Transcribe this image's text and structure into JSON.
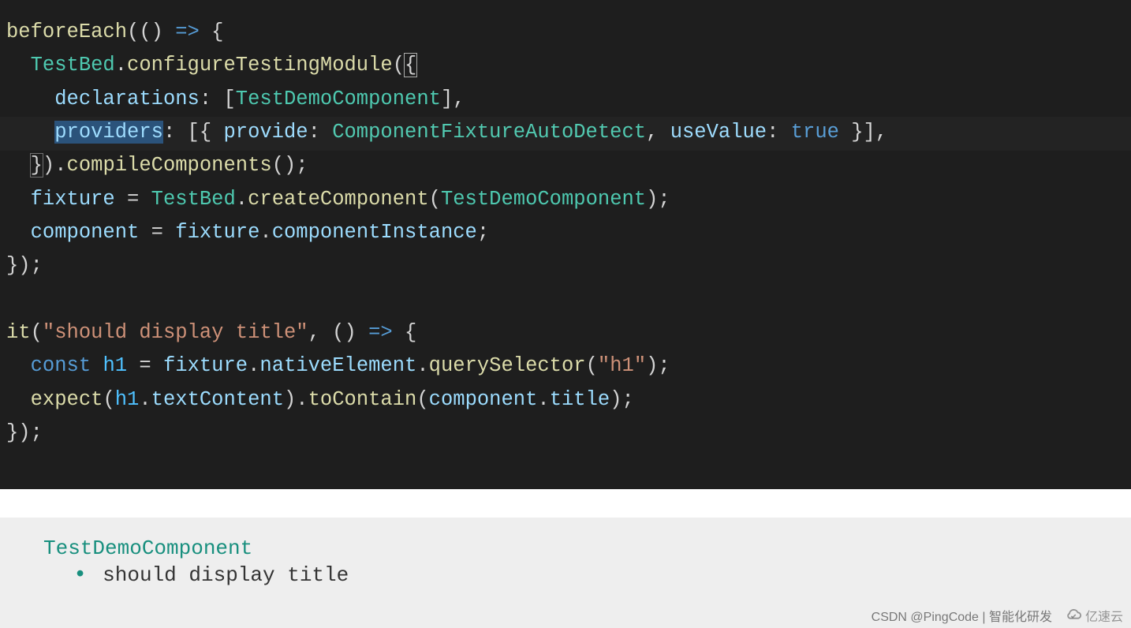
{
  "code": {
    "tokens": [
      [
        {
          "t": "beforeEach",
          "c": "t-fn"
        },
        {
          "t": "(() ",
          "c": "t-pn"
        },
        {
          "t": "=>",
          "c": "t-key"
        },
        {
          "t": " {",
          "c": "t-pn"
        }
      ],
      [
        {
          "t": "  ",
          "c": ""
        },
        {
          "t": "TestBed",
          "c": "t-cls"
        },
        {
          "t": ".",
          "c": "t-pn"
        },
        {
          "t": "configureTestingModule",
          "c": "t-fn"
        },
        {
          "t": "(",
          "c": "t-pn"
        },
        {
          "t": "{",
          "c": "t-pn cursor-box"
        }
      ],
      [
        {
          "t": "    ",
          "c": ""
        },
        {
          "t": "declarations",
          "c": "t-prop"
        },
        {
          "t": ": [",
          "c": "t-pn"
        },
        {
          "t": "TestDemoComponent",
          "c": "t-cls"
        },
        {
          "t": "],",
          "c": "t-pn"
        }
      ],
      [
        {
          "t": "    ",
          "c": ""
        },
        {
          "t": "providers",
          "c": "t-prop hl"
        },
        {
          "t": ": [{ ",
          "c": "t-pn"
        },
        {
          "t": "provide",
          "c": "t-prop"
        },
        {
          "t": ": ",
          "c": "t-pn"
        },
        {
          "t": "ComponentFixtureAutoDetect",
          "c": "t-cls"
        },
        {
          "t": ", ",
          "c": "t-pn"
        },
        {
          "t": "useValue",
          "c": "t-prop"
        },
        {
          "t": ": ",
          "c": "t-pn"
        },
        {
          "t": "true",
          "c": "t-key"
        },
        {
          "t": " }],",
          "c": "t-pn"
        }
      ],
      [
        {
          "t": "  ",
          "c": ""
        },
        {
          "t": "}",
          "c": "t-pn bracket-box"
        },
        {
          "t": ").",
          "c": "t-pn"
        },
        {
          "t": "compileComponents",
          "c": "t-fn"
        },
        {
          "t": "();",
          "c": "t-pn"
        }
      ],
      [
        {
          "t": "  ",
          "c": ""
        },
        {
          "t": "fixture",
          "c": "t-var"
        },
        {
          "t": " = ",
          "c": "t-op"
        },
        {
          "t": "TestBed",
          "c": "t-cls"
        },
        {
          "t": ".",
          "c": "t-pn"
        },
        {
          "t": "createComponent",
          "c": "t-fn"
        },
        {
          "t": "(",
          "c": "t-pn"
        },
        {
          "t": "TestDemoComponent",
          "c": "t-cls"
        },
        {
          "t": ");",
          "c": "t-pn"
        }
      ],
      [
        {
          "t": "  ",
          "c": ""
        },
        {
          "t": "component",
          "c": "t-var"
        },
        {
          "t": " = ",
          "c": "t-op"
        },
        {
          "t": "fixture",
          "c": "t-var"
        },
        {
          "t": ".",
          "c": "t-pn"
        },
        {
          "t": "componentInstance",
          "c": "t-var"
        },
        {
          "t": ";",
          "c": "t-pn"
        }
      ],
      [
        {
          "t": "});",
          "c": "t-pn"
        }
      ],
      [
        {
          "t": " ",
          "c": ""
        }
      ],
      [
        {
          "t": "it",
          "c": "t-fn"
        },
        {
          "t": "(",
          "c": "t-pn"
        },
        {
          "t": "\"should display title\"",
          "c": "t-str"
        },
        {
          "t": ", () ",
          "c": "t-pn"
        },
        {
          "t": "=>",
          "c": "t-key"
        },
        {
          "t": " {",
          "c": "t-pn"
        }
      ],
      [
        {
          "t": "  ",
          "c": ""
        },
        {
          "t": "const",
          "c": "t-key"
        },
        {
          "t": " ",
          "c": ""
        },
        {
          "t": "h1",
          "c": "t-const"
        },
        {
          "t": " = ",
          "c": "t-op"
        },
        {
          "t": "fixture",
          "c": "t-var"
        },
        {
          "t": ".",
          "c": "t-pn"
        },
        {
          "t": "nativeElement",
          "c": "t-var"
        },
        {
          "t": ".",
          "c": "t-pn"
        },
        {
          "t": "querySelector",
          "c": "t-fn"
        },
        {
          "t": "(",
          "c": "t-pn"
        },
        {
          "t": "\"h1\"",
          "c": "t-str"
        },
        {
          "t": ");",
          "c": "t-pn"
        }
      ],
      [
        {
          "t": "  ",
          "c": ""
        },
        {
          "t": "expect",
          "c": "t-fn"
        },
        {
          "t": "(",
          "c": "t-pn"
        },
        {
          "t": "h1",
          "c": "t-const"
        },
        {
          "t": ".",
          "c": "t-pn"
        },
        {
          "t": "textContent",
          "c": "t-var"
        },
        {
          "t": ").",
          "c": "t-pn"
        },
        {
          "t": "toContain",
          "c": "t-fn"
        },
        {
          "t": "(",
          "c": "t-pn"
        },
        {
          "t": "component",
          "c": "t-var"
        },
        {
          "t": ".",
          "c": "t-pn"
        },
        {
          "t": "title",
          "c": "t-var"
        },
        {
          "t": ");",
          "c": "t-pn"
        }
      ],
      [
        {
          "t": "});",
          "c": "t-pn"
        }
      ]
    ]
  },
  "results": {
    "suite": "TestDemoComponent",
    "item": "should display title"
  },
  "watermark": {
    "left": "CSDN @PingCode | 智能化研发",
    "right": "亿速云"
  }
}
